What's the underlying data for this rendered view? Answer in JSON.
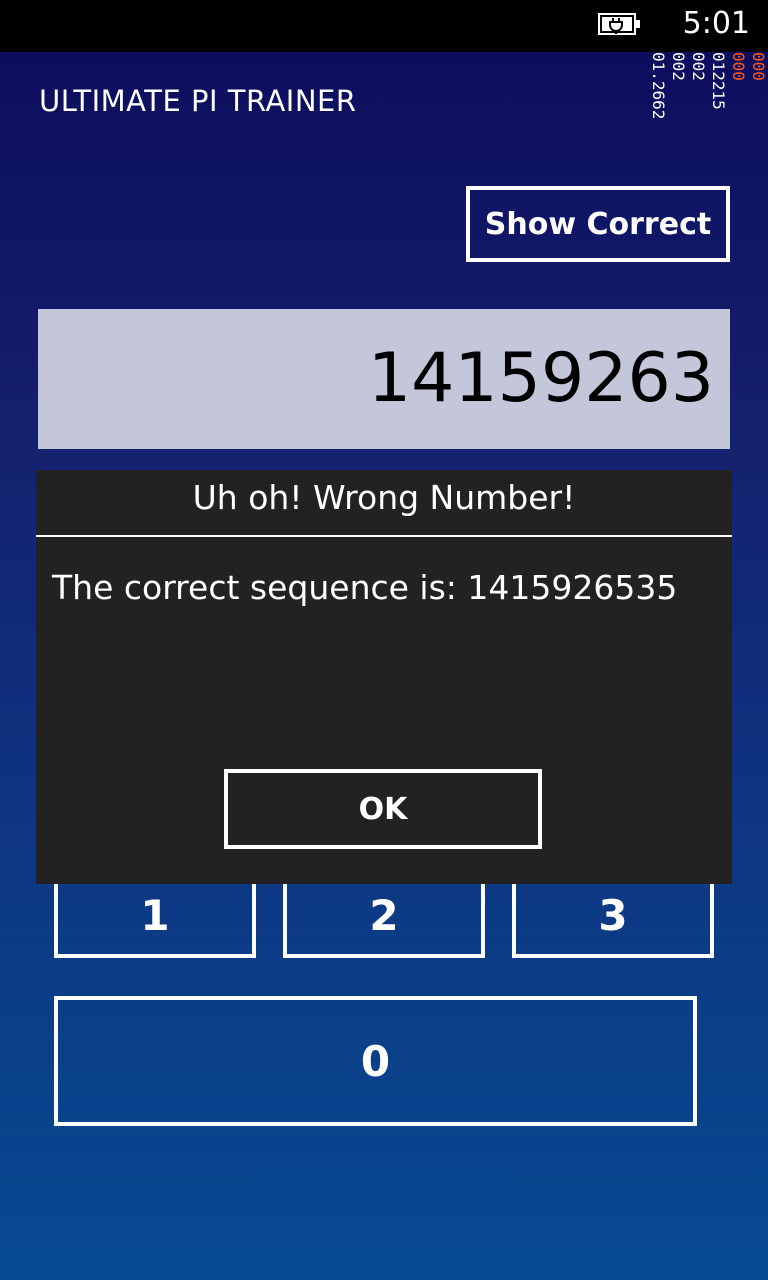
{
  "status_bar": {
    "time": "5:01",
    "battery_icon": "battery-charging-icon"
  },
  "app": {
    "title": "ULTIMATE PI TRAINER",
    "show_correct_label": "Show Correct",
    "sequence_value": "14159263",
    "keypad": {
      "key_1": "1",
      "key_2": "2",
      "key_3": "3",
      "key_0": "0"
    }
  },
  "debug_counters": [
    {
      "text": "000",
      "color": "#ff5a1e"
    },
    {
      "text": "000",
      "color": "#ff5a1e"
    },
    {
      "text": "012215",
      "color": "#ffffff"
    },
    {
      "text": "002",
      "color": "#ffffff"
    },
    {
      "text": "002",
      "color": "#ffffff"
    },
    {
      "text": "01.2662",
      "color": "#ffffff"
    }
  ],
  "dialog": {
    "title": "Uh oh! Wrong Number!",
    "message": "The correct sequence is: 1415926535",
    "ok_label": "OK"
  }
}
